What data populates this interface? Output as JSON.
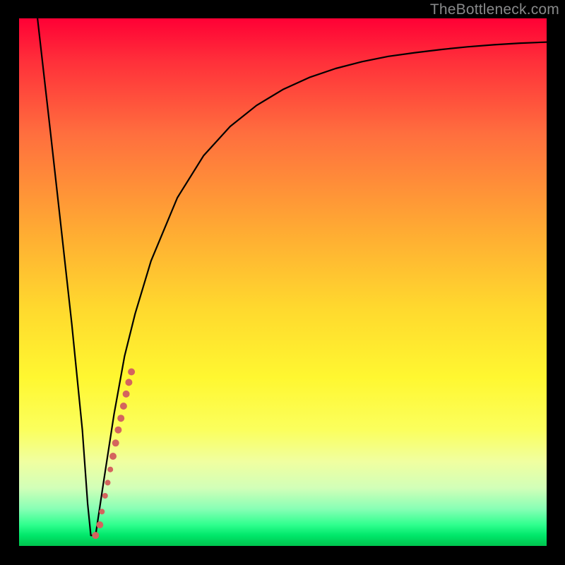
{
  "watermark": "TheBottleneck.com",
  "chart_data": {
    "type": "line",
    "title": "",
    "xlabel": "",
    "ylabel": "",
    "xlim": [
      0,
      100
    ],
    "ylim": [
      0,
      100
    ],
    "grid": false,
    "legend": false,
    "background_gradient": {
      "direction": "vertical",
      "stops": [
        {
          "pos": 0.0,
          "color": "#ff0035"
        },
        {
          "pos": 0.4,
          "color": "#ffaa33"
        },
        {
          "pos": 0.7,
          "color": "#fff730"
        },
        {
          "pos": 0.9,
          "color": "#a0ffb0"
        },
        {
          "pos": 1.0,
          "color": "#00c44e"
        }
      ]
    },
    "series": [
      {
        "name": "bottleneck-curve",
        "color": "#000000",
        "x": [
          3.5,
          6,
          8,
          10,
          12,
          13,
          13.6,
          14.5,
          16,
          18,
          20,
          22,
          25,
          30,
          35,
          40,
          45,
          50,
          55,
          60,
          65,
          70,
          75,
          80,
          85,
          90,
          95,
          100
        ],
        "y": [
          100,
          78,
          60,
          42,
          22,
          8,
          2,
          2,
          12,
          25,
          36,
          44,
          54,
          66,
          74,
          79.5,
          83.5,
          86.5,
          88.8,
          90.5,
          91.8,
          92.8,
          93.5,
          94.1,
          94.6,
          95.0,
          95.3,
          95.5
        ]
      }
    ],
    "markers": [
      {
        "name": "highlight-dots",
        "color": "#d4645e",
        "shape": "circle",
        "points": [
          {
            "x": 14.5,
            "y": 2.0,
            "r": 5
          },
          {
            "x": 15.3,
            "y": 4.0,
            "r": 5
          },
          {
            "x": 15.7,
            "y": 6.5,
            "r": 4
          },
          {
            "x": 16.3,
            "y": 9.5,
            "r": 4
          },
          {
            "x": 16.8,
            "y": 12.0,
            "r": 4
          },
          {
            "x": 17.3,
            "y": 14.5,
            "r": 4
          },
          {
            "x": 17.8,
            "y": 17.0,
            "r": 5
          },
          {
            "x": 18.3,
            "y": 19.5,
            "r": 5
          },
          {
            "x": 18.8,
            "y": 22.0,
            "r": 5
          },
          {
            "x": 19.3,
            "y": 24.2,
            "r": 5
          },
          {
            "x": 19.8,
            "y": 26.5,
            "r": 5
          },
          {
            "x": 20.3,
            "y": 28.8,
            "r": 5
          },
          {
            "x": 20.8,
            "y": 31.0,
            "r": 5
          },
          {
            "x": 21.3,
            "y": 33.0,
            "r": 5
          }
        ]
      }
    ]
  }
}
